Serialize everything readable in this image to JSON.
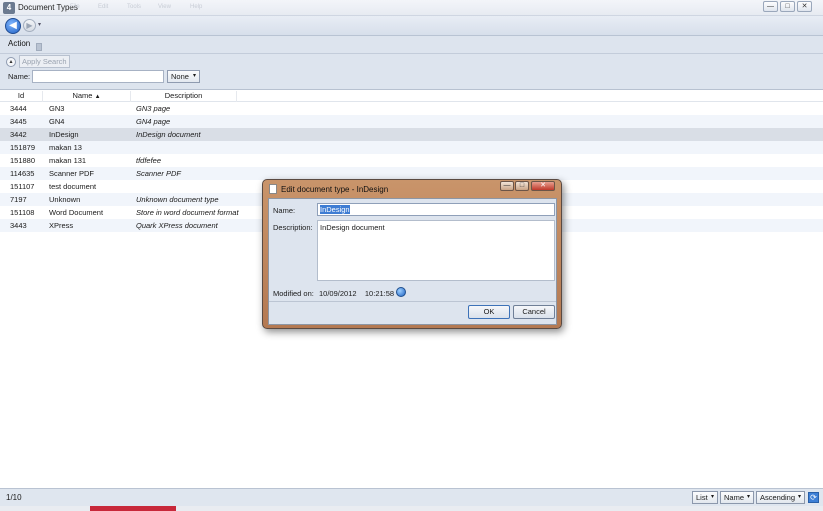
{
  "window": {
    "title": "Document Types",
    "ghost_menu": [
      "File",
      "Edit",
      "Tools",
      "View",
      "Help"
    ],
    "controls": {
      "minimize": "—",
      "maximize": "□",
      "close": "✕"
    }
  },
  "nav": {
    "back": "◀",
    "forward": "▶",
    "history": "▾"
  },
  "actionbar": {
    "menu_label": "Action"
  },
  "search": {
    "collapse_glyph": "▴",
    "apply_label": "Apply Search",
    "name_label": "Name:",
    "name_value": "",
    "mode_value": "None"
  },
  "grid": {
    "columns": {
      "id": "Id",
      "name": "Name",
      "description": "Description"
    },
    "sort_glyph": "▲",
    "rows": [
      {
        "id": "3444",
        "name": "GN3",
        "description": "GN3 page"
      },
      {
        "id": "3445",
        "name": "GN4",
        "description": "GN4 page"
      },
      {
        "id": "3442",
        "name": "InDesign",
        "description": "InDesign document"
      },
      {
        "id": "151879",
        "name": "makan 13",
        "description": ""
      },
      {
        "id": "151880",
        "name": "makan 131",
        "description": "tfdfefee"
      },
      {
        "id": "114635",
        "name": "Scanner PDF",
        "description": "Scanner PDF"
      },
      {
        "id": "151107",
        "name": "test document",
        "description": ""
      },
      {
        "id": "7197",
        "name": "Unknown",
        "description": "Unknown document type"
      },
      {
        "id": "151108",
        "name": "Word Document",
        "description": "Store in word document format"
      },
      {
        "id": "3443",
        "name": "XPress",
        "description": "Quark XPress document"
      }
    ],
    "selected_index": 2
  },
  "status": {
    "count": "1/10",
    "view_mode": "List",
    "sort_field": "Name",
    "sort_order": "Ascending",
    "refresh_glyph": "⟳",
    "dropdown_glyph": "▾"
  },
  "dialog": {
    "title": "Edit document type - InDesign",
    "controls": {
      "minimize": "—",
      "maximize": "□",
      "close": "✕"
    },
    "name_label": "Name:",
    "name_value": "InDesign",
    "description_label": "Description:",
    "description_value": "InDesign document",
    "modified_label": "Modified on:",
    "modified_date": "10/09/2012",
    "modified_time": "10:21:58",
    "ok_label": "OK",
    "cancel_label": "Cancel"
  }
}
